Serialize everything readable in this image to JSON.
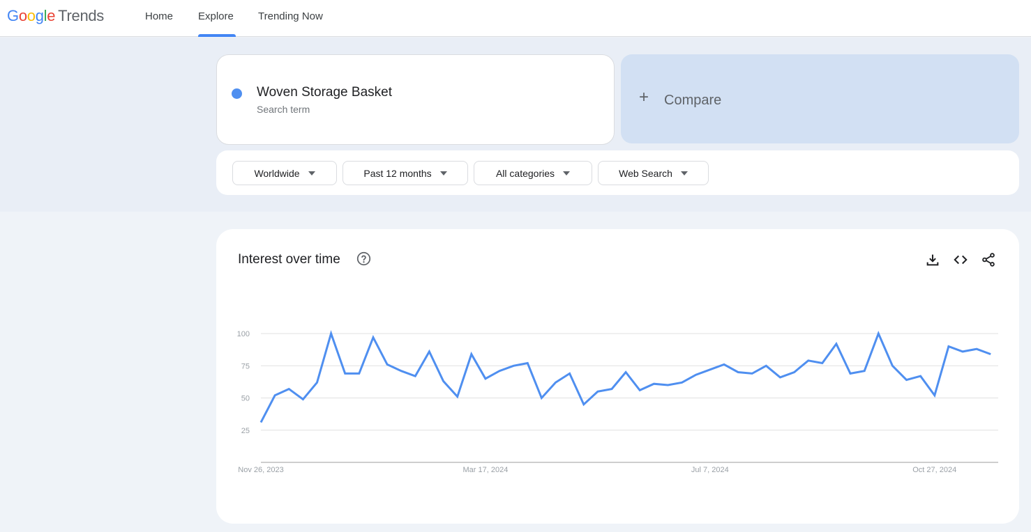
{
  "header": {
    "logo": {
      "google": [
        "G",
        "o",
        "o",
        "g",
        "l",
        "e"
      ],
      "product": "Trends"
    },
    "nav": [
      {
        "label": "Home",
        "active": false
      },
      {
        "label": "Explore",
        "active": true
      },
      {
        "label": "Trending Now",
        "active": false
      }
    ]
  },
  "search_term": {
    "name": "Woven Storage Basket",
    "type": "Search term",
    "color": "#4f8ff0"
  },
  "compare": {
    "icon": "plus-icon",
    "label": "Compare"
  },
  "filters": [
    {
      "label": "Worldwide",
      "icon": "caret-down-icon"
    },
    {
      "label": "Past 12 months",
      "icon": "caret-down-icon"
    },
    {
      "label": "All categories",
      "icon": "caret-down-icon"
    },
    {
      "label": "Web Search",
      "icon": "caret-down-icon"
    }
  ],
  "chart_card": {
    "title": "Interest over time",
    "icons": [
      "help-icon",
      "download-icon",
      "embed-code-icon",
      "share-icon"
    ]
  },
  "chart_data": {
    "type": "line",
    "title": "Interest over time",
    "xlabel": "",
    "ylabel": "",
    "ylim": [
      0,
      100
    ],
    "yticks": [
      25,
      50,
      75,
      100
    ],
    "xtick_labels": [
      {
        "label": "Nov 26, 2023",
        "index": 0
      },
      {
        "label": "Mar 17, 2024",
        "index": 16
      },
      {
        "label": "Jul 7, 2024",
        "index": 32
      },
      {
        "label": "Oct 27, 2024",
        "index": 48
      }
    ],
    "grid": true,
    "legend": "none",
    "series": [
      {
        "name": "Woven Storage Basket",
        "color": "#4f8ff0",
        "values": [
          31,
          52,
          57,
          49,
          62,
          100,
          69,
          69,
          97,
          76,
          71,
          67,
          86,
          63,
          51,
          84,
          65,
          71,
          75,
          77,
          50,
          62,
          69,
          45,
          55,
          57,
          70,
          56,
          61,
          60,
          62,
          68,
          72,
          76,
          70,
          69,
          75,
          66,
          70,
          79,
          77,
          92,
          69,
          71,
          100,
          75,
          64,
          67,
          52,
          90,
          86,
          88,
          84
        ]
      }
    ]
  }
}
